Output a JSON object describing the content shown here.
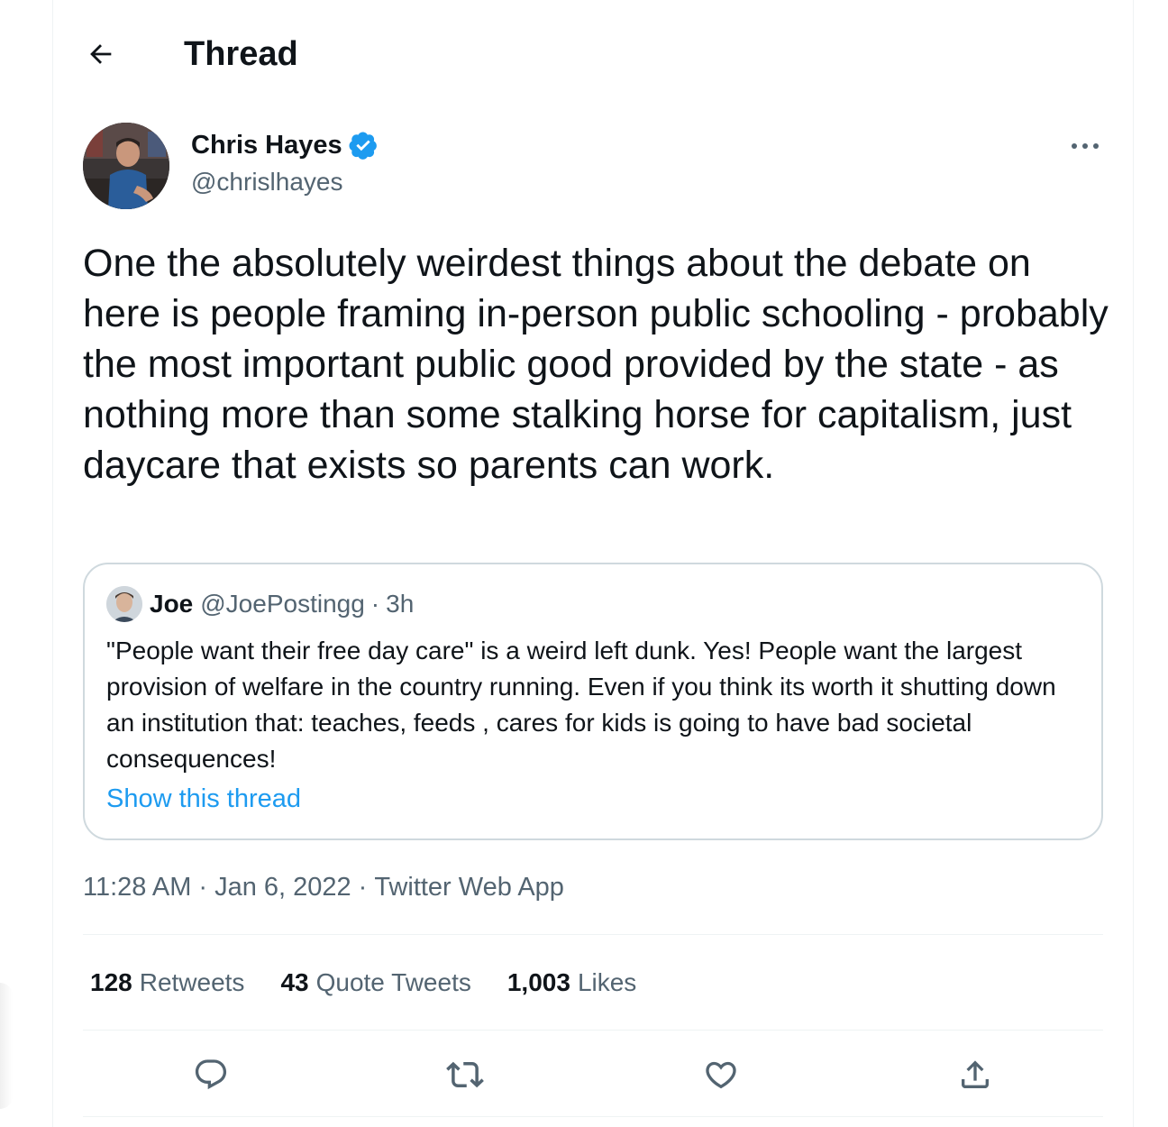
{
  "header": {
    "title": "Thread",
    "back_icon": "arrow-left-icon"
  },
  "tweet": {
    "author_name": "Chris Hayes",
    "author_handle": "@chrislhayes",
    "text": "One the absolutely weirdest things about the debate on here is people framing in-person public schooling - probably the most important public good provided by the state - as nothing more than some stalking horse for capitalism, just daycare that exists so parents can work.",
    "time": "11:28 AM",
    "date": "Jan 6, 2022",
    "source": "Twitter Web App",
    "separator": "·"
  },
  "quote": {
    "name": "Joe",
    "handle": "@JoePostingg",
    "separator": "·",
    "time": "3h",
    "text": "\"People want their free day care\" is a weird left dunk. Yes! People want the largest provision of welfare in the country running. Even if you think its worth it shutting down an institution that: teaches, feeds , cares for kids is going to have bad societal consequences!",
    "show_thread": "Show this thread"
  },
  "stats": {
    "retweets_count": "128",
    "retweets_label": "Retweets",
    "quotes_count": "43",
    "quotes_label": "Quote Tweets",
    "likes_count": "1,003",
    "likes_label": "Likes"
  },
  "actions": [
    "reply-icon",
    "retweet-icon",
    "like-icon",
    "share-icon"
  ],
  "colors": {
    "accent": "#1d9bf0",
    "text": "#0f1419",
    "secondary": "#536471",
    "border": "#cfd9de"
  }
}
